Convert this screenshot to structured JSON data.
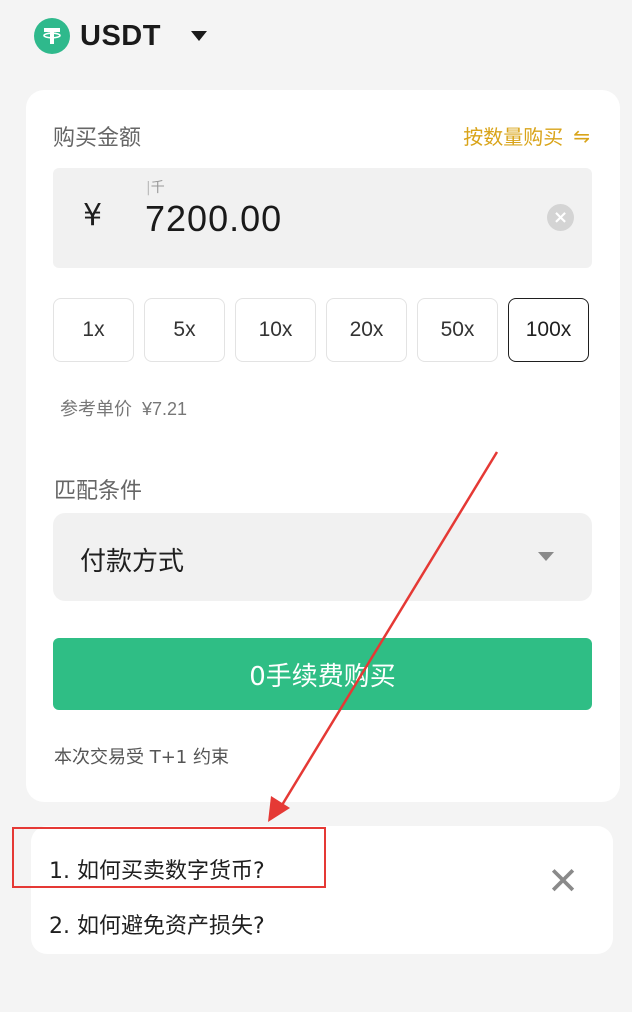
{
  "header": {
    "coin_symbol": "USDT",
    "logo_icon": "tether-icon"
  },
  "purchase": {
    "amount_label": "购买金额",
    "by_quantity_label": "按数量购买",
    "currency_symbol": "¥",
    "unit_hint": "千",
    "amount_value": "7200.00",
    "multipliers": [
      "1x",
      "5x",
      "10x",
      "20x",
      "50x",
      "100x"
    ],
    "selected_multiplier": "100x",
    "reference_price_label": "参考单价",
    "reference_price_value": "¥7.21"
  },
  "matching": {
    "label": "匹配条件",
    "payment_method_label": "付款方式"
  },
  "buy_button_label": "0手续费购买",
  "t1_note": "本次交易受 T+1 约束",
  "faq": {
    "items": [
      "1. 如何买卖数字货币?",
      "2. 如何避免资产损失?"
    ]
  },
  "colors": {
    "accent_green": "#2fbe85",
    "gold": "#d9a41a",
    "annotation_red": "#e53935"
  }
}
